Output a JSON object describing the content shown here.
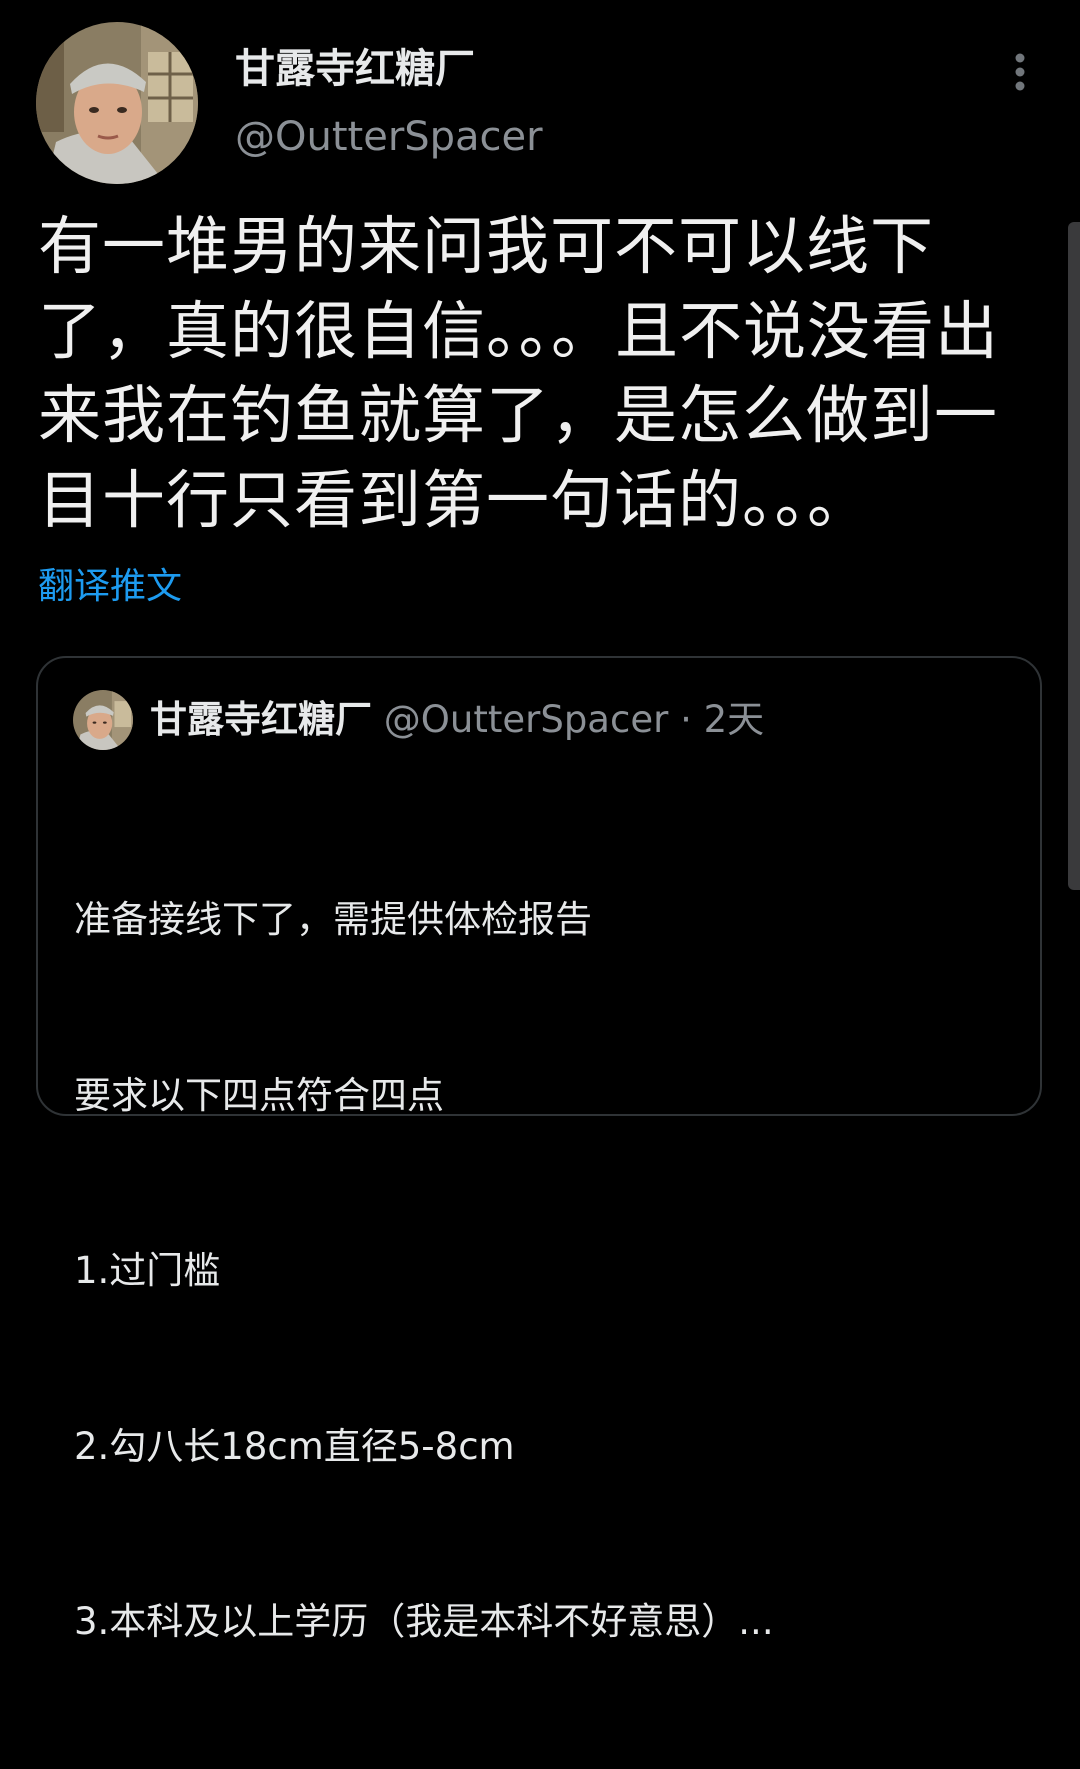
{
  "tweet": {
    "display_name": "甘露寺红糖厂",
    "handle": "@OutterSpacer",
    "text": "有一堆男的来问我可不可以线下了，真的很自信。。。且不说没看出来我在钓鱼就算了，是怎么做到一目十行只看到第一句话的。。。",
    "translate_label": "翻译推文"
  },
  "quoted_tweet": {
    "display_name": "甘露寺红糖厂",
    "handle": "@OutterSpacer",
    "separator": "·",
    "time": "2天",
    "lines": [
      "准备接线下了，需提供体检报告",
      "要求以下四点符合四点",
      "1.过门槛",
      "2.勾八长18cm直径5-8cm",
      "3.本科及以上学历（我是本科不好意思）..."
    ]
  },
  "colors": {
    "background": "#000000",
    "text_primary": "#e7e9ea",
    "text_secondary": "#8b9096",
    "link": "#1d9bf0",
    "border": "#2f3336"
  },
  "icons": {
    "more": "more-vertical-icon",
    "avatar": "user-avatar"
  }
}
